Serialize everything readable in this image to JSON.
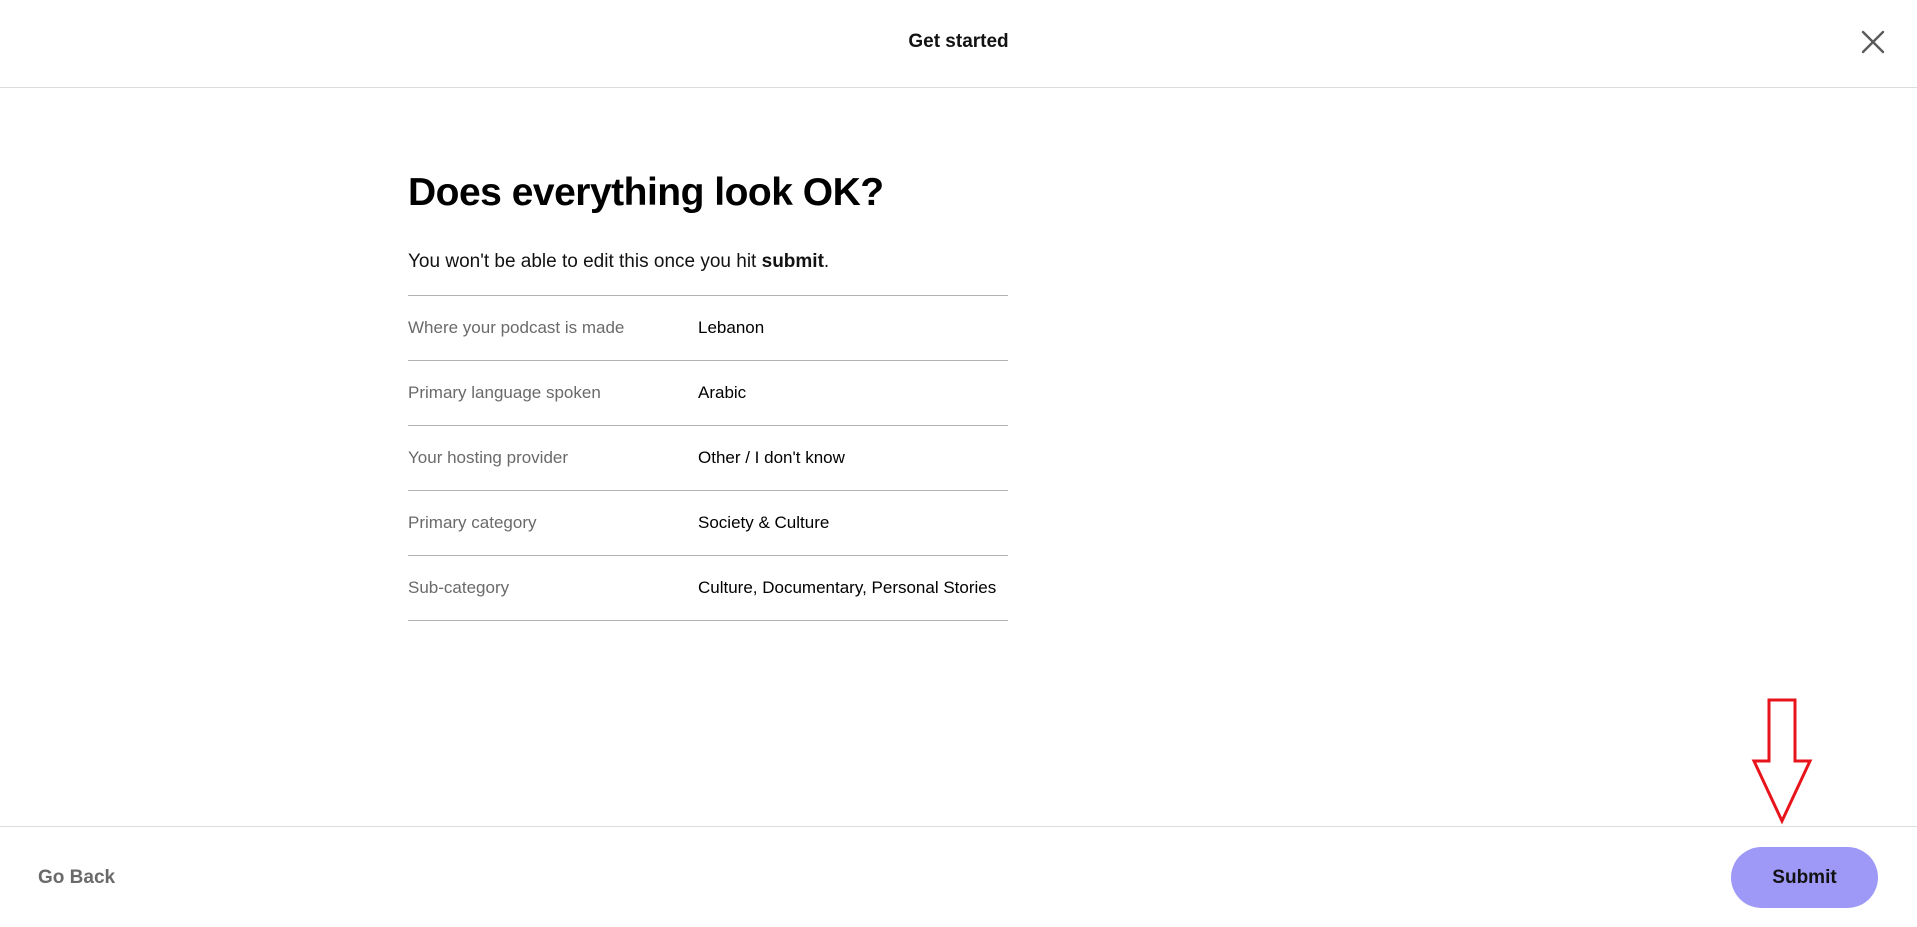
{
  "header": {
    "title": "Get started",
    "close_icon": "close-icon"
  },
  "main": {
    "heading": "Does everything look OK?",
    "subtext_prefix": "You won't be able to edit this once you hit ",
    "subtext_bold": "submit",
    "subtext_suffix": ".",
    "rows": [
      {
        "label": "Where your podcast is made",
        "value": "Lebanon"
      },
      {
        "label": "Primary language spoken",
        "value": "Arabic"
      },
      {
        "label": "Your hosting provider",
        "value": "Other / I don't know"
      },
      {
        "label": "Primary category",
        "value": "Society & Culture"
      },
      {
        "label": "Sub-category",
        "value": "Culture, Documentary, Personal Stories"
      }
    ]
  },
  "footer": {
    "go_back_label": "Go Back",
    "submit_label": "Submit"
  },
  "annotation": {
    "arrow_icon": "down-arrow-icon",
    "arrow_color": "#e8141c"
  },
  "colors": {
    "submit_bg": "#9e99f7",
    "label_gray": "#6a6a6a",
    "divider": "#b3b3b3"
  }
}
